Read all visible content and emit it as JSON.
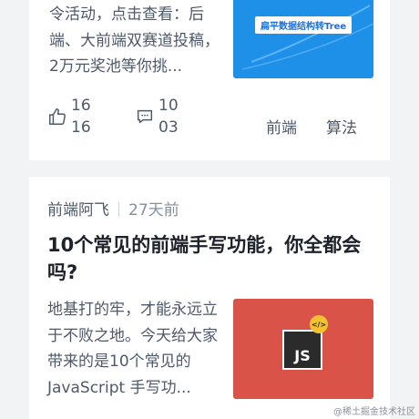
{
  "article1": {
    "summary": "令活动，点击查看：后端、大前端双赛道投稿，2万元奖池等你挑...",
    "thumbnail_text": "扁平数据结构转Tree",
    "likes": "1616",
    "comments": "1003",
    "tags": [
      "前端",
      "算法"
    ]
  },
  "article2": {
    "author": "前端阿飞",
    "time": "27天前",
    "title": "10个常见的前端手写功能，你全都会吗?",
    "summary": "地基打的牢，才能永远立于不败之地。今天给大家带来的是10个常见的 JavaScript 手写功...",
    "thumbnail_text": "JS",
    "thumbnail_badge": "</>"
  },
  "watermark": "@稀土掘金技术社区",
  "colors": {
    "page_bg": "#f2f3f5",
    "card_bg": "#ffffff",
    "text_primary": "#1d2129",
    "text_secondary": "#4e5969",
    "thumb_blue": "#1e90e8",
    "thumb_red": "#d95348"
  }
}
